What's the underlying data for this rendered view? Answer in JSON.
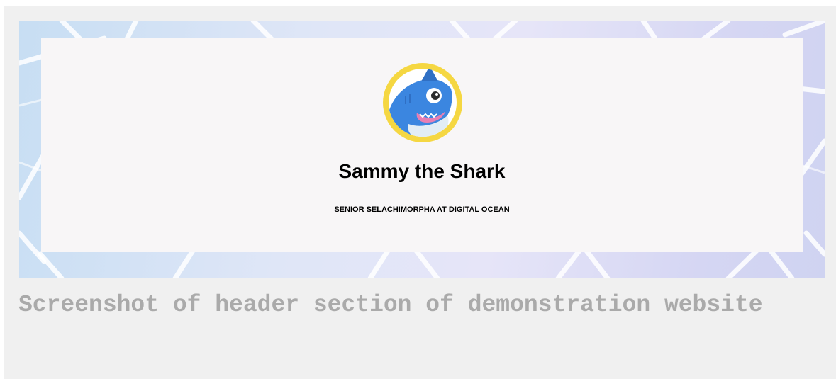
{
  "header": {
    "name": "Sammy the Shark",
    "title": "SENIOR SELACHIMORPHA AT DIGITAL OCEAN",
    "avatar_icon": "shark-mascot-icon"
  },
  "caption": {
    "text": "Screenshot of header section of demonstration website"
  },
  "colors": {
    "card_background": "#f8f6f7",
    "avatar_ring": "#f5d742",
    "shark_body": "#3b86e0",
    "caption_text": "#aaaaaa",
    "page_frame": "#f0f0f0"
  }
}
